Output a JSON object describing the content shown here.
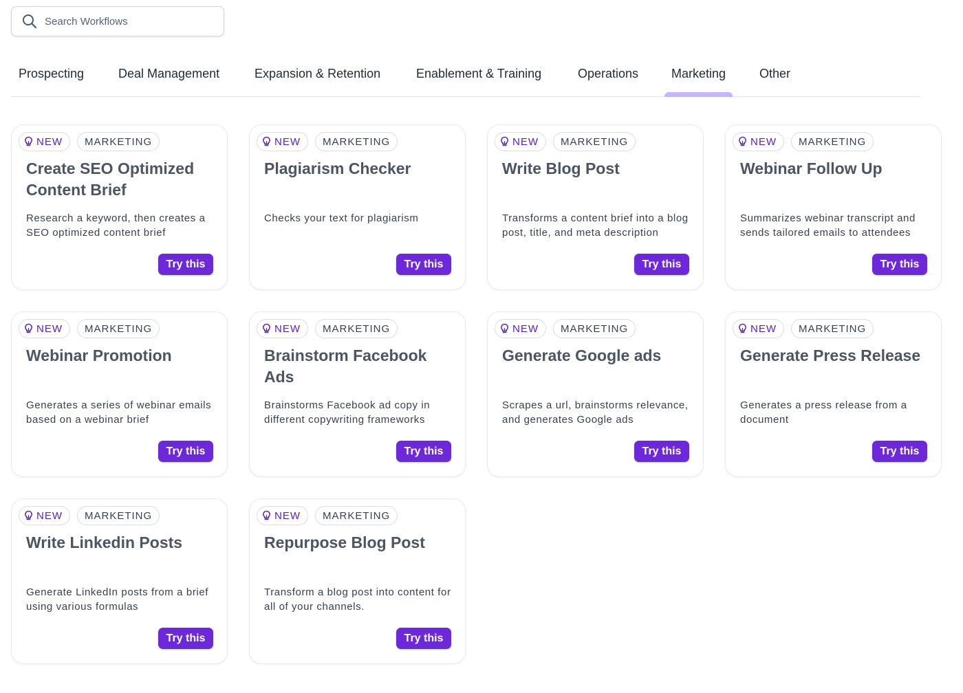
{
  "search": {
    "placeholder": "Search Workflows",
    "value": ""
  },
  "tabs": [
    {
      "label": "Prospecting",
      "active": false
    },
    {
      "label": "Deal Management",
      "active": false
    },
    {
      "label": "Expansion & Retention",
      "active": false
    },
    {
      "label": "Enablement & Training",
      "active": false
    },
    {
      "label": "Operations",
      "active": false
    },
    {
      "label": "Marketing",
      "active": true
    },
    {
      "label": "Other",
      "active": false
    }
  ],
  "colors": {
    "accent": "#6d28d9",
    "active_tab_indicator": "#c4b5fd",
    "new_badge_text": "#5b21b6"
  },
  "cards": [
    {
      "badge_new": "NEW",
      "badge_category": "MARKETING",
      "title": "Create SEO Optimized Content Brief",
      "description": "Research a keyword, then creates a SEO optimized content brief",
      "button": "Try this"
    },
    {
      "badge_new": "NEW",
      "badge_category": "MARKETING",
      "title": "Plagiarism Checker",
      "description": "Checks your text for plagiarism",
      "button": "Try this"
    },
    {
      "badge_new": "NEW",
      "badge_category": "MARKETING",
      "title": "Write Blog Post",
      "description": "Transforms a content brief into a blog post, title, and meta description",
      "button": "Try this"
    },
    {
      "badge_new": "NEW",
      "badge_category": "MARKETING",
      "title": "Webinar Follow Up",
      "description": "Summarizes webinar transcript and sends tailored emails to attendees",
      "button": "Try this"
    },
    {
      "badge_new": "NEW",
      "badge_category": "MARKETING",
      "title": "Webinar Promotion",
      "description": "Generates a series of webinar emails based on a webinar brief",
      "button": "Try this"
    },
    {
      "badge_new": "NEW",
      "badge_category": "MARKETING",
      "title": "Brainstorm Facebook Ads",
      "description": "Brainstorms Facebook ad copy in different copywriting frameworks",
      "button": "Try this"
    },
    {
      "badge_new": "NEW",
      "badge_category": "MARKETING",
      "title": "Generate Google ads",
      "description": "Scrapes a url, brainstorms relevance, and generates Google ads",
      "button": "Try this"
    },
    {
      "badge_new": "NEW",
      "badge_category": "MARKETING",
      "title": "Generate Press Release",
      "description": "Generates a press release from a document",
      "button": "Try this"
    },
    {
      "badge_new": "NEW",
      "badge_category": "MARKETING",
      "title": "Write Linkedin Posts",
      "description": "Generate LinkedIn posts from a brief using various formulas",
      "button": "Try this"
    },
    {
      "badge_new": "NEW",
      "badge_category": "MARKETING",
      "title": "Repurpose Blog Post",
      "description": "Transform a blog post into content for all of your channels.",
      "button": "Try this"
    }
  ]
}
